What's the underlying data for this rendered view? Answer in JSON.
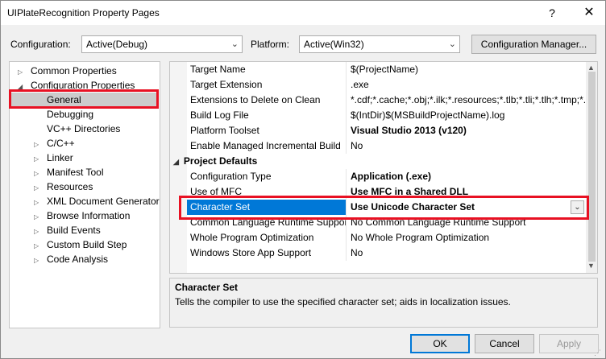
{
  "window": {
    "title": "UIPlateRecognition Property Pages",
    "help_glyph": "?",
    "close_glyph": "✕"
  },
  "toolbar": {
    "configuration_label": "Configuration:",
    "configuration_value": "Active(Debug)",
    "platform_label": "Platform:",
    "platform_value": "Active(Win32)",
    "config_manager_label": "Configuration Manager..."
  },
  "tree": {
    "items": [
      {
        "label": "Common Properties",
        "expander": "▷",
        "level": 0
      },
      {
        "label": "Configuration Properties",
        "expander": "◢",
        "level": 0
      },
      {
        "label": "General",
        "expander": "",
        "level": 1,
        "selected": true
      },
      {
        "label": "Debugging",
        "expander": "",
        "level": 1
      },
      {
        "label": "VC++ Directories",
        "expander": "",
        "level": 1
      },
      {
        "label": "C/C++",
        "expander": "▷",
        "level": 1
      },
      {
        "label": "Linker",
        "expander": "▷",
        "level": 1
      },
      {
        "label": "Manifest Tool",
        "expander": "▷",
        "level": 1
      },
      {
        "label": "Resources",
        "expander": "▷",
        "level": 1
      },
      {
        "label": "XML Document Generator",
        "expander": "▷",
        "level": 1
      },
      {
        "label": "Browse Information",
        "expander": "▷",
        "level": 1
      },
      {
        "label": "Build Events",
        "expander": "▷",
        "level": 1
      },
      {
        "label": "Custom Build Step",
        "expander": "▷",
        "level": 1
      },
      {
        "label": "Code Analysis",
        "expander": "▷",
        "level": 1
      }
    ]
  },
  "grid": {
    "rows": [
      {
        "name": "Target Name",
        "value": "$(ProjectName)"
      },
      {
        "name": "Target Extension",
        "value": ".exe"
      },
      {
        "name": "Extensions to Delete on Clean",
        "value": "*.cdf;*.cache;*.obj;*.ilk;*.resources;*.tlb;*.tli;*.tlh;*.tmp;*.rsp;*"
      },
      {
        "name": "Build Log File",
        "value": "$(IntDir)$(MSBuildProjectName).log"
      },
      {
        "name": "Platform Toolset",
        "value": "Visual Studio 2013 (v120)",
        "bold": true
      },
      {
        "name": "Enable Managed Incremental Build",
        "value": "No"
      },
      {
        "category": true,
        "name": "Project Defaults",
        "tri": "◢"
      },
      {
        "name": "Configuration Type",
        "value": "Application (.exe)",
        "bold": true
      },
      {
        "name": "Use of MFC",
        "value": "Use MFC in a Shared DLL",
        "bold": true
      },
      {
        "name": "Character Set",
        "value": "Use Unicode Character Set",
        "bold": true,
        "selected": true,
        "dropdown": "⌄"
      },
      {
        "name": "Common Language Runtime Support",
        "value": "No Common Language Runtime Support"
      },
      {
        "name": "Whole Program Optimization",
        "value": "No Whole Program Optimization"
      },
      {
        "name": "Windows Store App Support",
        "value": "No"
      }
    ]
  },
  "description": {
    "title": "Character Set",
    "text": "Tells the compiler to use the specified character set; aids in localization issues."
  },
  "buttons": {
    "ok": "OK",
    "cancel": "Cancel",
    "apply": "Apply"
  },
  "colors": {
    "highlight": "#e81123",
    "selection": "#0078d7"
  }
}
